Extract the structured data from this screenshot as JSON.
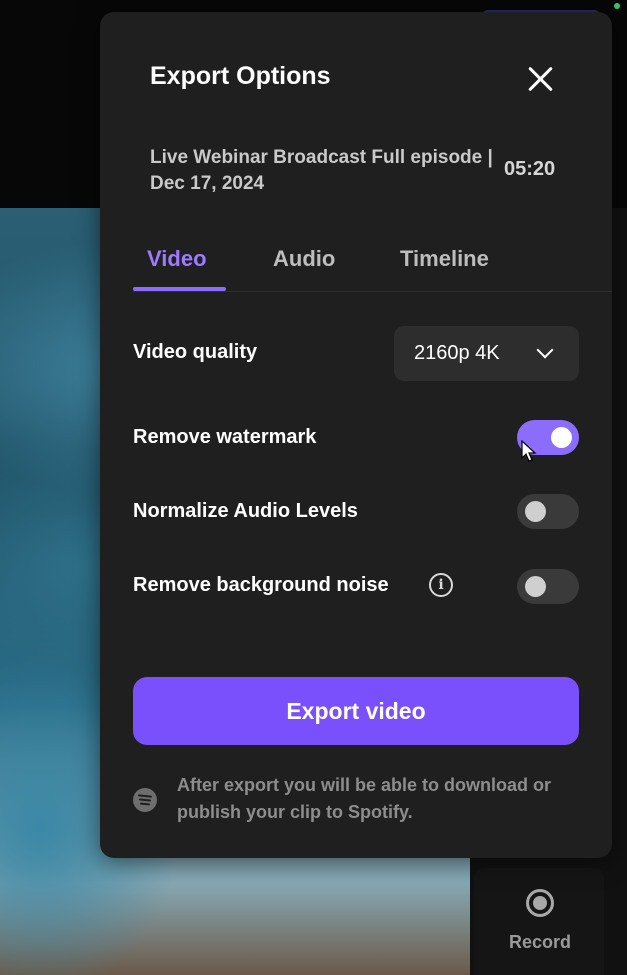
{
  "dialog": {
    "title": "Export Options",
    "episode_title": "Live Webinar Broadcast Full episode | Dec 17, 2024",
    "duration": "05:20"
  },
  "tabs": [
    {
      "label": "Video",
      "active": true
    },
    {
      "label": "Audio",
      "active": false
    },
    {
      "label": "Timeline",
      "active": false
    }
  ],
  "settings": {
    "video_quality_label": "Video quality",
    "video_quality_value": "2160p 4K",
    "remove_watermark_label": "Remove watermark",
    "remove_watermark_on": true,
    "normalize_audio_label": "Normalize Audio Levels",
    "normalize_audio_on": false,
    "remove_noise_label": "Remove background noise",
    "remove_noise_on": false
  },
  "export_button_label": "Export video",
  "footer_text": "After export you will be able to download or publish your clip to Spotify.",
  "background": {
    "record_label": "Record"
  },
  "colors": {
    "accent": "#8c6dfb",
    "export_button": "#7a4ffc",
    "panel": "#1f1f1f"
  },
  "icons": [
    "close-icon",
    "chevron-down-icon",
    "info-icon",
    "spotify-icon",
    "record-icon",
    "cursor-icon"
  ]
}
